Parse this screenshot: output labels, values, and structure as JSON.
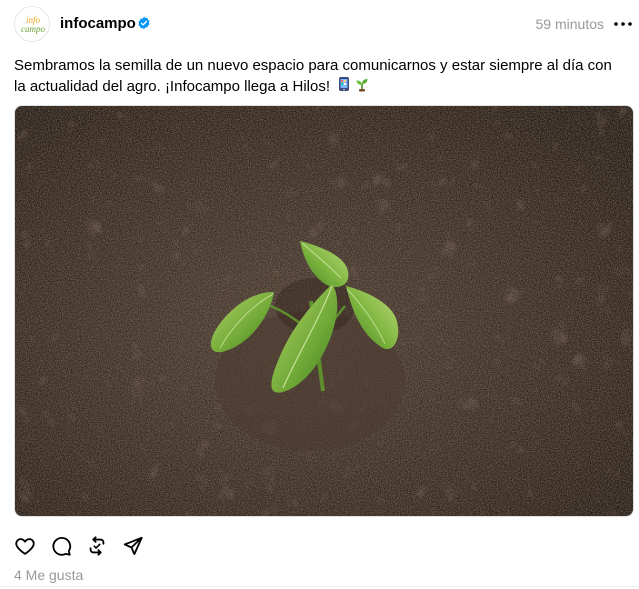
{
  "post": {
    "author": {
      "username": "infocampo",
      "avatar_text": [
        "info",
        "campo"
      ],
      "verified": true,
      "verified_icon": "verified-badge-icon"
    },
    "timestamp": "59 minutos",
    "more_icon": "more-icon",
    "caption": "Sembramos la semilla de un nuevo espacio para comunicarnos y estar siempre al día con la actualidad del agro. ¡Infocampo llega a Hilos!",
    "caption_emojis": [
      "phone-emoji",
      "seedling-emoji"
    ],
    "image": {
      "subject": "seedling-in-soil"
    },
    "actions": {
      "like_icon": "heart-icon",
      "comment_icon": "comment-icon",
      "repost_icon": "repost-icon",
      "share_icon": "share-icon"
    },
    "likes_text": "4 Me gusta"
  },
  "colors": {
    "text": "#000000",
    "muted": "#999999",
    "verified": "#0095f6",
    "brand_orange": "#f0a21a",
    "brand_green": "#6aa53a",
    "soil": "#3b2c22"
  }
}
